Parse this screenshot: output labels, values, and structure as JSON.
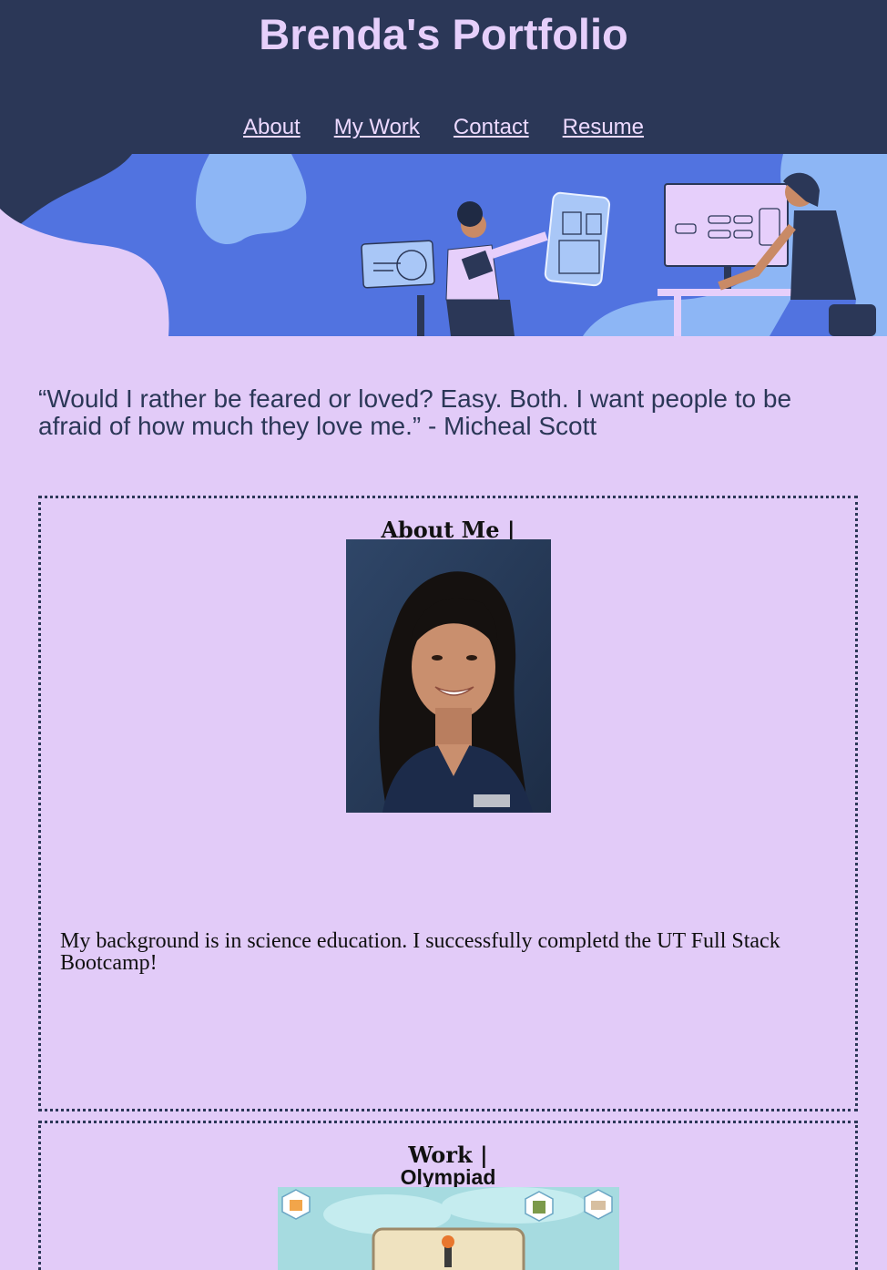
{
  "header": {
    "title": "Brenda's Portfolio",
    "nav": [
      "About",
      "My Work",
      "Contact",
      "Resume"
    ]
  },
  "hero": {
    "alt": "illustration of people working on computers and charts"
  },
  "quote": "“Would I rather be feared or loved? Easy. Both. I want people to be afraid of how much they love me.” - Micheal Scott",
  "about": {
    "title": "About Me |",
    "bio": "My background is in science education. I successfully completd the UT Full Stack Bootcamp!"
  },
  "work": {
    "title": "Work |",
    "project_title": "Olympiad"
  },
  "colors": {
    "header_bg": "#2b3757",
    "page_bg": "#e2cbf8",
    "title": "#e6cffb",
    "hero_blue": "#5173e0"
  }
}
